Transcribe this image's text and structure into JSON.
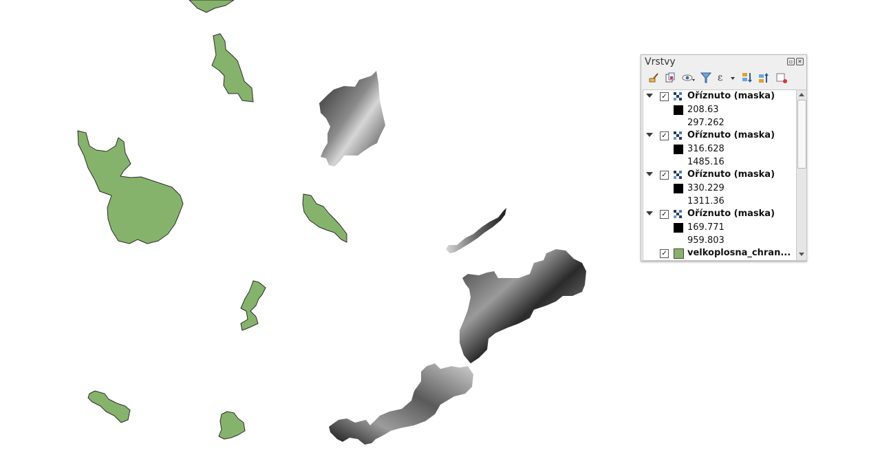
{
  "panel": {
    "title": "Vrstvy",
    "title_buttons": [
      "restore-icon",
      "close-icon"
    ],
    "toolbar": [
      "style-brush-icon",
      "add-group-icon",
      "visibility-eye-icon",
      "filter-icon",
      "expression-filter-icon",
      "expand-all-icon",
      "collapse-all-icon",
      "remove-layer-icon"
    ]
  },
  "layers": [
    {
      "name": "Oříznuto (maska)",
      "checked": true,
      "type": "raster",
      "legend": {
        "low": "208.63",
        "high": "297.262"
      }
    },
    {
      "name": "Oříznuto (maska)",
      "checked": true,
      "type": "raster",
      "legend": {
        "low": "316.628",
        "high": "1485.16"
      }
    },
    {
      "name": "Oříznuto (maska)",
      "checked": true,
      "type": "raster",
      "legend": {
        "low": "330.229",
        "high": "1311.36"
      }
    },
    {
      "name": "Oříznuto (maska)",
      "checked": true,
      "type": "raster",
      "legend": {
        "low": "169.771",
        "high": "959.803"
      }
    },
    {
      "name": "velkoplosna_chran...",
      "checked": true,
      "type": "vector",
      "color": "#86b36b"
    }
  ],
  "checkbox_mark": "✓",
  "colors": {
    "polygon_fill": "#86b36b",
    "polygon_stroke": "#2a2a2a",
    "canvas": "#ffffff"
  }
}
